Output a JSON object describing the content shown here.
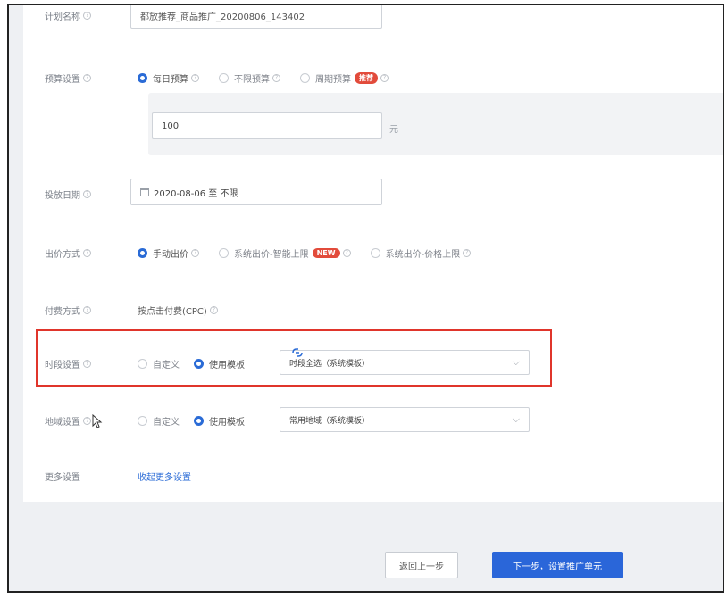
{
  "form": {
    "plan_name": {
      "label": "计划名称",
      "value": "都放推荐_商品推广_20200806_143402"
    },
    "budget": {
      "label": "预算设置",
      "options": [
        {
          "label": "每日预算",
          "selected": true
        },
        {
          "label": "不限预算",
          "selected": false
        },
        {
          "label": "周期预算",
          "selected": false,
          "badge": "推荐"
        }
      ],
      "amount": "100",
      "unit": "元"
    },
    "date": {
      "label": "投放日期",
      "value": "2020-08-06 至 不限"
    },
    "bid": {
      "label": "出价方式",
      "options": [
        {
          "label": "手动出价",
          "selected": true
        },
        {
          "label": "系统出价-智能上限",
          "selected": false,
          "badge": "NEW"
        },
        {
          "label": "系统出价-价格上限",
          "selected": false
        }
      ]
    },
    "payment": {
      "label": "付费方式",
      "value": "按点击付费(CPC)"
    },
    "schedule": {
      "label": "时段设置",
      "options": [
        {
          "label": "自定义",
          "selected": false
        },
        {
          "label": "使用模板",
          "selected": true
        }
      ],
      "template": "时段全选（系统模板）"
    },
    "region": {
      "label": "地域设置",
      "options": [
        {
          "label": "自定义",
          "selected": false
        },
        {
          "label": "使用模板",
          "selected": true
        }
      ],
      "template": "常用地域（系统模板）"
    },
    "more": {
      "label": "更多设置",
      "link": "收起更多设置"
    }
  },
  "footer": {
    "prev_label": "返回上一步",
    "next_label": "下一步，设置推广单元"
  },
  "colors": {
    "primary": "#2a66d9",
    "highlight": "#e0352b",
    "badge": "#e24b3b"
  }
}
